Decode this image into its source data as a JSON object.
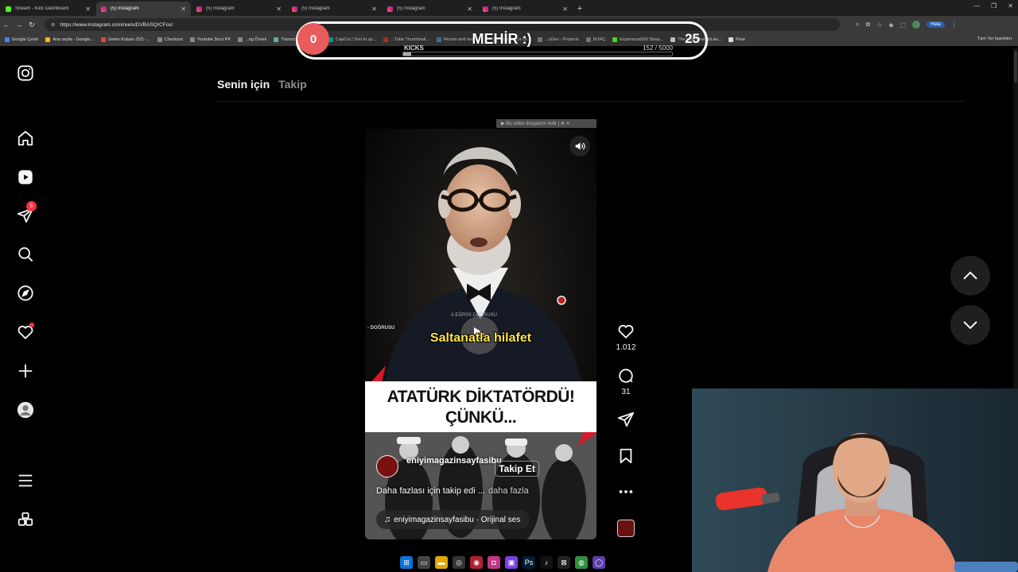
{
  "browser": {
    "tabs": [
      {
        "label": "Stream - Kick Dashboard",
        "type": "kick"
      },
      {
        "label": "(5) Instagram",
        "type": "ig",
        "active": true
      },
      {
        "label": "(5) Instagram",
        "type": "ig"
      },
      {
        "label": "(5) Instagram",
        "type": "ig"
      },
      {
        "label": "(5) Instagram",
        "type": "ig"
      },
      {
        "label": "(5) Instagram",
        "type": "ig"
      }
    ],
    "url": "https://www.instagram.com/reels/DVBASQrCFox/",
    "profile_label": "Hata",
    "bookmarks": [
      "Google Çeviri",
      "Ana sayfa - Google...",
      "Gelen Kutusu (52) -...",
      "Checkout",
      "Youtube 3ncü PK",
      "...ng Örnek",
      "Transcript of \"Mİ M...",
      "CapCut | Text to sp...",
      "...Tube Thumbnail...",
      "Resize and reduce i...",
      "İspanyolca Ör...",
      "...yGen - Projects",
      "BURÇ",
      "Esperanza000 Strea...",
      "The best ChatBot an...",
      "Flow"
    ],
    "bookmarks_all": "Tüm Yer İşaretleri"
  },
  "kicks_overlay": {
    "left_value": "0",
    "title": "MEHİR :)",
    "right_value": "25",
    "label": "KICKS",
    "count": "152  / 5000",
    "progress_fraction": 0.03
  },
  "instagram": {
    "feed_tabs": {
      "active": "Senin için",
      "inactive": "Takip"
    },
    "sidebar": {
      "notification_count": "5"
    },
    "download_chip": "▶ Bu video dosyasını indir | ⊗ ✕",
    "reel": {
      "watermark_left": "- DOĞRUSU",
      "watermark_center": "A EĞRİSİ DOĞRUSU",
      "subtitle": "Saltanatla hilafet",
      "headline_line1": "ATATÜRK DİKTATÖRDÜ!",
      "headline_line2": "ÇÜNKÜ...",
      "author": "eniyimagazinsayfasibu",
      "follow_label": "Takip Et",
      "caption": "Daha fazlası için takip edi ...",
      "caption_more": "daha fazla",
      "audio": "eniyimagazinsayfasibu · Orijinal ses"
    },
    "actions": {
      "likes": "1.012",
      "comments": "31"
    }
  },
  "colors": {
    "accent_red": "#ff3040",
    "subtitle_yellow": "#ffe54a",
    "kick_green": "#53fc18",
    "headline_red": "#d8182a"
  }
}
